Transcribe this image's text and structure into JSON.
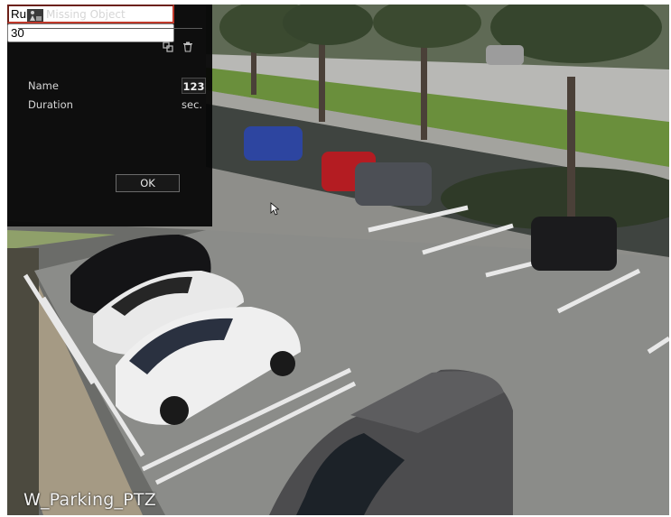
{
  "dialog": {
    "title": "Missing Object",
    "header_icon": "missing-object-icon",
    "tools": [
      {
        "name": "copy-icon"
      },
      {
        "name": "delete-icon"
      }
    ],
    "fields": {
      "name_label": "Name",
      "name_value": "Rule1",
      "keyboard_button": "123",
      "duration_label": "Duration",
      "duration_value": "30",
      "duration_unit": "sec."
    },
    "ok_label": "OK"
  },
  "camera": {
    "label": "W_Parking_PTZ"
  },
  "colors": {
    "dialog_bg": "#060606",
    "name_field_border": "#c0392b"
  }
}
